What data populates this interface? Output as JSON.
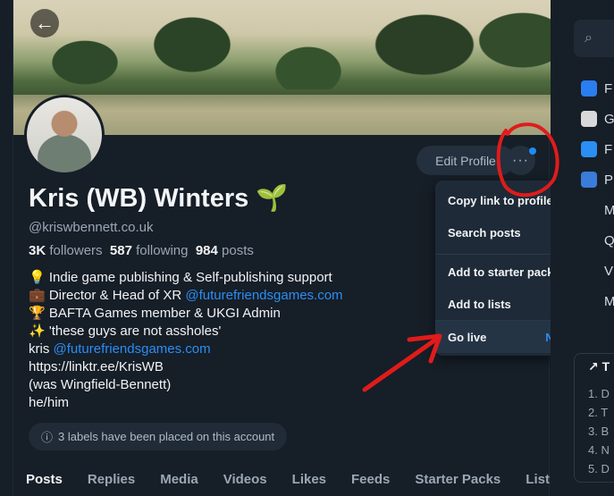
{
  "profile": {
    "name": "Kris (WB) Winters 🌱",
    "handle": "@kriswbennett.co.uk",
    "followers_count": "3K",
    "followers_label": "followers",
    "following_count": "587",
    "following_label": "following",
    "posts_count": "984",
    "posts_label": "posts",
    "edit_label": "Edit Profile",
    "more_label": "···",
    "back_icon": "←"
  },
  "bio": {
    "line1": "💡 Indie game publishing & Self-publishing support",
    "line2_prefix": "💼 Director & Head of XR ",
    "line2_link": "@futurefriendsgames.com",
    "line3": "🏆 BAFTA Games member & UKGI Admin",
    "line4": "✨ 'these guys are not assholes'",
    "line5_prefix": "kris ",
    "line5_link": "@futurefriendsgames.com",
    "line6": "https://linktr.ee/KrisWB",
    "line7": "(was Wingfield-Bennett)",
    "line8": "he/him"
  },
  "labels_notice": "3 labels have been placed on this account",
  "tabs": [
    "Posts",
    "Replies",
    "Media",
    "Videos",
    "Likes",
    "Feeds",
    "Starter Packs",
    "List"
  ],
  "menu": {
    "copy_link": "Copy link to profile",
    "search_posts": "Search posts",
    "add_starter": "Add to starter packs",
    "add_lists": "Add to lists",
    "go_live": "Go live",
    "go_live_badge": "New"
  },
  "sidebar": {
    "search_icon": "⌕",
    "feeds": [
      {
        "label": "F",
        "color": "#2a7ef0"
      },
      {
        "label": "G",
        "color": "#d8d8d8"
      },
      {
        "label": "F",
        "color": "#2a8ef5"
      },
      {
        "label": "P",
        "color": "#3b7bd9"
      },
      {
        "label": "M",
        "color": ""
      },
      {
        "label": "Q",
        "color": ""
      },
      {
        "label": "V",
        "color": ""
      },
      {
        "label": "M",
        "color": ""
      }
    ],
    "trending_title": "T",
    "trending": [
      "1.  D",
      "2.  T",
      "3.  B",
      "4.  N",
      "5.  D"
    ]
  },
  "colors": {
    "accent": "#1d8cf8",
    "annotation": "#e01b1b"
  }
}
